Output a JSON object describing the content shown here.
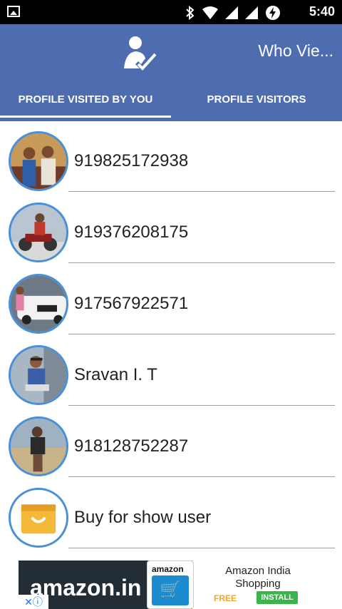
{
  "status_bar": {
    "time": "5:40",
    "icons": [
      "image-icon",
      "bluetooth-icon",
      "wifi-icon",
      "signal-icon",
      "signal-icon",
      "battery-charging-icon"
    ]
  },
  "header": {
    "title": "Who Vie...",
    "logo_icon": "user-check-icon"
  },
  "tabs": [
    {
      "label": "PROFILE VISITED BY YOU",
      "selected": true
    },
    {
      "label": "PROFILE VISITORS",
      "selected": false
    }
  ],
  "items": [
    {
      "name": "919825172938",
      "avatar": "photo-couple"
    },
    {
      "name": "919376208175",
      "avatar": "photo-motorbike"
    },
    {
      "name": "917567922571",
      "avatar": "photo-car"
    },
    {
      "name": "Sravan I. T",
      "avatar": "photo-person-sitting"
    },
    {
      "name": "918128752287",
      "avatar": "photo-person-standing"
    },
    {
      "name": "Buy for show user",
      "avatar": "shopping-bag-icon"
    }
  ],
  "ad": {
    "brand_text": "amazon.in",
    "app_label": "amazon",
    "title": "Amazon India Shopping",
    "price": "FREE",
    "cta": "INSTALL",
    "adchoices_icon": "adchoices-icon"
  },
  "colors": {
    "primary": "#4e6cb0",
    "avatar_border": "#4a90d9",
    "install_green": "#39b54a",
    "free_orange": "#f6a623"
  }
}
